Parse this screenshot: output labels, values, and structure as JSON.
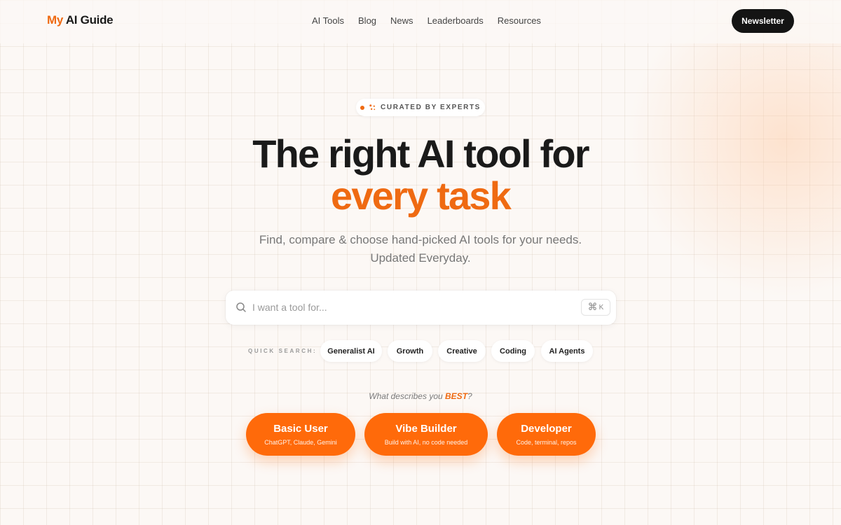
{
  "nav": {
    "logo_accent": "My",
    "logo_rest": " AI Guide",
    "links": [
      "AI Tools",
      "Blog",
      "News",
      "Leaderboards",
      "Resources"
    ],
    "newsletter_label": "Newsletter"
  },
  "hero": {
    "badge_icon": "sparkle-icon",
    "badge_text": "CURATED BY EXPERTS",
    "headline_line1": "The right AI tool for",
    "headline_line2": "every task",
    "subtitle_line1": "Find, compare & choose hand-picked AI tools for your needs.",
    "subtitle_line2": "Updated Everyday."
  },
  "search": {
    "placeholder": "I want a tool for...",
    "value": "",
    "shortcut_symbol": "⌘",
    "shortcut_key": "K"
  },
  "quick_search": {
    "label": "QUICK SEARCH:",
    "chips": [
      "Generalist AI",
      "Growth",
      "Creative",
      "Coding",
      "AI Agents"
    ]
  },
  "persona": {
    "question_prefix": "What describes you",
    "question_emphasis": "BEST",
    "question_suffix": "?",
    "options": [
      {
        "title": "Basic User",
        "subtitle": "ChatGPT, Claude, Gemini"
      },
      {
        "title": "Vibe Builder",
        "subtitle": "Build with AI, no code needed"
      },
      {
        "title": "Developer",
        "subtitle": "Code, terminal, repos"
      }
    ]
  },
  "colors": {
    "accent": "#ef6a12",
    "button_orange": "#ff6a0a",
    "dark_button": "#141414",
    "background": "#fcf8f5"
  }
}
